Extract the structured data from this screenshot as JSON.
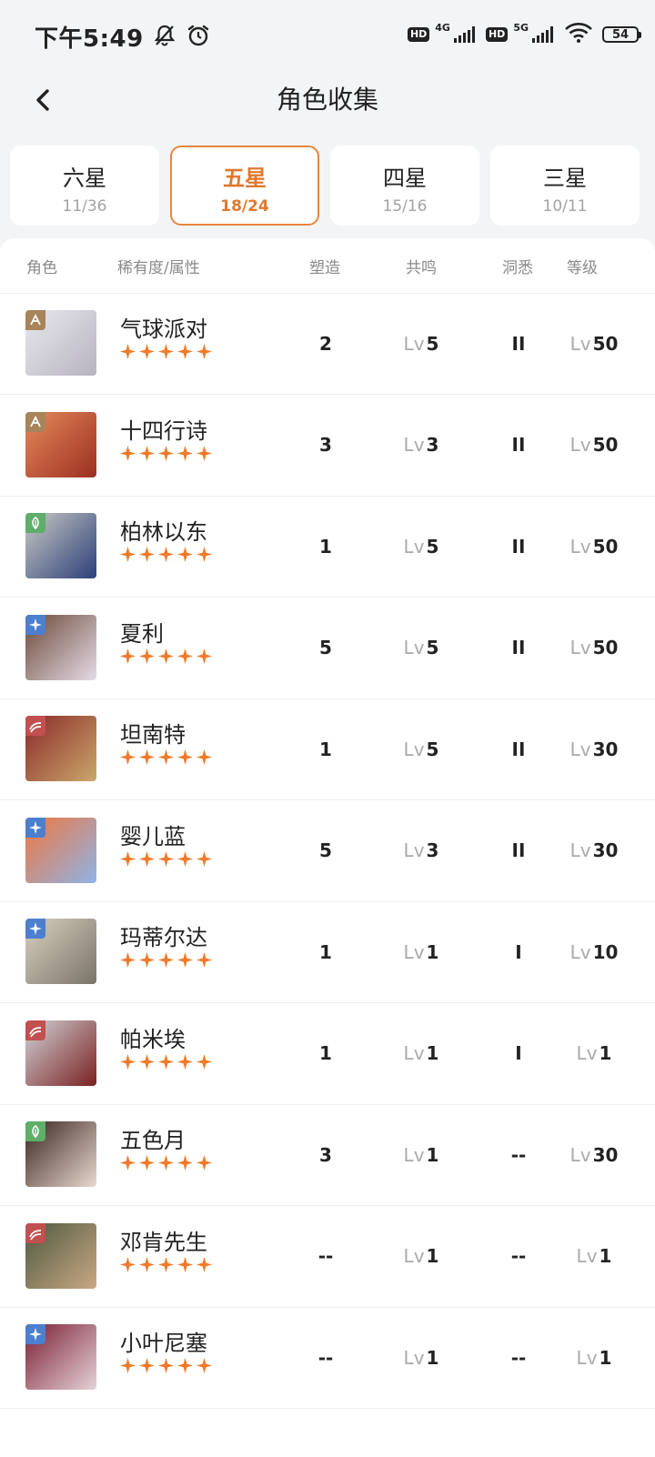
{
  "status_bar": {
    "time": "下午5:49",
    "net1": "4G",
    "net2": "5G",
    "hd": "HD",
    "battery": "54"
  },
  "header": {
    "title": "角色收集"
  },
  "tabs": [
    {
      "label": "六星",
      "count": "11/36",
      "active": false
    },
    {
      "label": "五星",
      "count": "18/24",
      "active": true
    },
    {
      "label": "四星",
      "count": "15/16",
      "active": false
    },
    {
      "label": "三星",
      "count": "10/11",
      "active": false
    }
  ],
  "table": {
    "headers": {
      "role": "角色",
      "rarity": "稀有度/属性",
      "forge": "塑造",
      "resonance": "共鸣",
      "insight": "洞悉",
      "level": "等级"
    },
    "lv_prefix": "Lv",
    "rows": [
      {
        "name": "气球派对",
        "element": "beast-icon",
        "forge": "2",
        "resonance": "5",
        "insight": "II",
        "level": "50"
      },
      {
        "name": "十四行诗",
        "element": "beast-icon",
        "forge": "3",
        "resonance": "3",
        "insight": "II",
        "level": "50"
      },
      {
        "name": "柏林以东",
        "element": "plant-icon",
        "forge": "1",
        "resonance": "5",
        "insight": "II",
        "level": "50"
      },
      {
        "name": "夏利",
        "element": "star-icon",
        "forge": "5",
        "resonance": "5",
        "insight": "II",
        "level": "50"
      },
      {
        "name": "坦南特",
        "element": "wave-icon",
        "forge": "1",
        "resonance": "5",
        "insight": "II",
        "level": "30"
      },
      {
        "name": "婴儿蓝",
        "element": "star-icon",
        "forge": "5",
        "resonance": "3",
        "insight": "II",
        "level": "30"
      },
      {
        "name": "玛蒂尔达",
        "element": "star-icon",
        "forge": "1",
        "resonance": "1",
        "insight": "I",
        "level": "10"
      },
      {
        "name": "帕米埃",
        "element": "wave-icon",
        "forge": "1",
        "resonance": "1",
        "insight": "I",
        "level": "1"
      },
      {
        "name": "五色月",
        "element": "plant-icon",
        "forge": "3",
        "resonance": "1",
        "insight": "--",
        "level": "30"
      },
      {
        "name": "邓肯先生",
        "element": "wave-icon",
        "forge": "--",
        "resonance": "1",
        "insight": "--",
        "level": "1"
      },
      {
        "name": "小叶尼塞",
        "element": "star-icon",
        "forge": "--",
        "resonance": "1",
        "insight": "--",
        "level": "1"
      }
    ]
  },
  "colors": {
    "accent": "#e0782e",
    "star": "#f07a2a",
    "beast": "#a8845a",
    "plant": "#5fae6a",
    "star_elem": "#4d7fcf",
    "wave": "#c25050"
  }
}
